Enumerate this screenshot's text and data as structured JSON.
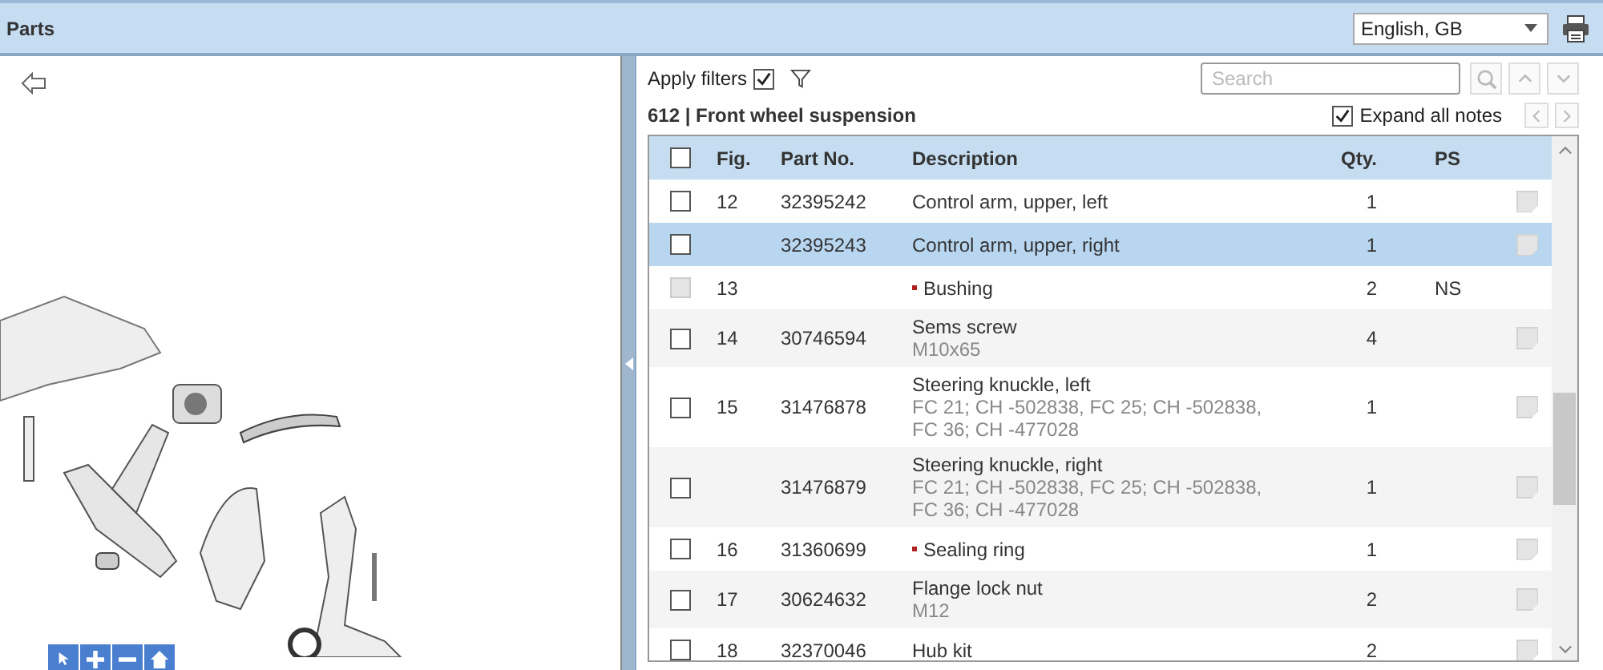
{
  "header": {
    "title": "Parts",
    "language": {
      "value": "English, GB"
    }
  },
  "diagram": {
    "kind": "picture"
  },
  "toolbar": {
    "apply_filters": {
      "label": "Apply filters",
      "checked": true
    },
    "search": {
      "placeholder": "Search"
    },
    "expand_notes": {
      "label": "Expand all notes",
      "checked": true
    }
  },
  "group_title": "612 | Front wheel suspension",
  "table": {
    "select_all": {
      "checked": false
    },
    "columns": [
      "Fig.",
      "Part No.",
      "Description",
      "Qty.",
      "PS"
    ],
    "rows": [
      {
        "fig": "12",
        "part_no": "32395242",
        "description": "Control arm, upper, left",
        "qty": "1",
        "selected": false,
        "checked": false,
        "disabled": false,
        "bulleted": false,
        "note": true
      },
      {
        "part_no": "32395243",
        "description": "Control arm, upper, right",
        "qty": "1",
        "selected": true,
        "checked": false,
        "disabled": false,
        "bulleted": false,
        "note": true
      },
      {
        "fig": "13",
        "description": "Bushing",
        "qty": "2",
        "ps": "NS",
        "selected": false,
        "checked": false,
        "disabled": true,
        "bulleted": true,
        "note": false
      },
      {
        "fig": "14",
        "part_no": "30746594",
        "description": "Sems screw",
        "detail": "M10x65",
        "qty": "4",
        "selected": false,
        "checked": false,
        "disabled": false,
        "bulleted": false,
        "note": true
      },
      {
        "fig": "15",
        "part_no": "31476878",
        "description": "Steering knuckle, left",
        "detail": "FC 21; CH -502838, FC 25; CH -502838, FC 36; CH -477028",
        "qty": "1",
        "selected": false,
        "checked": false,
        "disabled": false,
        "bulleted": false,
        "note": true
      },
      {
        "part_no": "31476879",
        "description": "Steering knuckle, right",
        "detail": "FC 21; CH -502838, FC 25; CH -502838, FC 36; CH -477028",
        "qty": "1",
        "selected": false,
        "checked": false,
        "disabled": false,
        "bulleted": false,
        "note": true
      },
      {
        "fig": "16",
        "part_no": "31360699",
        "description": "Sealing ring",
        "qty": "1",
        "selected": false,
        "checked": false,
        "disabled": false,
        "bulleted": true,
        "note": true
      },
      {
        "fig": "17",
        "part_no": "30624632",
        "description": "Flange lock nut",
        "detail": "M12",
        "qty": "2",
        "selected": false,
        "checked": false,
        "disabled": false,
        "bulleted": false,
        "note": true
      },
      {
        "fig": "18",
        "part_no": "32370046",
        "description": "Hub kit",
        "qty": "2",
        "selected": false,
        "checked": false,
        "disabled": false,
        "bulleted": false,
        "note": true
      }
    ]
  }
}
